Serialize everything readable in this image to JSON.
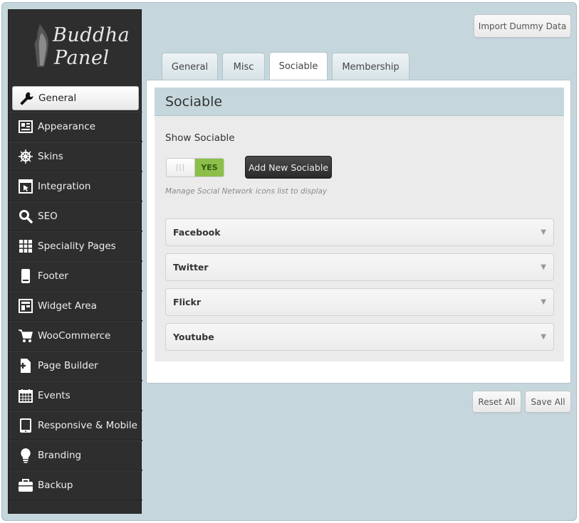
{
  "app": {
    "logo_line1": "Buddha",
    "logo_line2": "Panel"
  },
  "sidebar": {
    "items": [
      {
        "label": "General",
        "icon": "wrench-icon",
        "active": true
      },
      {
        "label": "Appearance",
        "icon": "newspaper-icon"
      },
      {
        "label": "Skins",
        "icon": "ship-wheel-icon"
      },
      {
        "label": "Integration",
        "icon": "window-cursor-icon"
      },
      {
        "label": "SEO",
        "icon": "search-icon"
      },
      {
        "label": "Speciality Pages",
        "icon": "grid-icon"
      },
      {
        "label": "Footer",
        "icon": "phone-device-icon"
      },
      {
        "label": "Widget Area",
        "icon": "layout-icon"
      },
      {
        "label": "WooCommerce",
        "icon": "cart-icon"
      },
      {
        "label": "Page Builder",
        "icon": "page-add-icon"
      },
      {
        "label": "Events",
        "icon": "calendar-icon"
      },
      {
        "label": "Responsive & Mobile",
        "icon": "tablet-icon"
      },
      {
        "label": "Branding",
        "icon": "lightbulb-icon"
      },
      {
        "label": "Backup",
        "icon": "briefcase-icon"
      }
    ]
  },
  "header": {
    "import_label": "Import Dummy Data"
  },
  "tabs": [
    {
      "label": "General"
    },
    {
      "label": "Misc"
    },
    {
      "label": "Sociable",
      "active": true
    },
    {
      "label": "Membership"
    }
  ],
  "section": {
    "title": "Sociable",
    "show_label": "Show Sociable",
    "toggle_on": "YES",
    "add_button": "Add New Sociable",
    "hint": "Manage Social Network icons list to display",
    "networks": [
      {
        "label": "Facebook"
      },
      {
        "label": "Twitter"
      },
      {
        "label": "Flickr"
      },
      {
        "label": "Youtube"
      }
    ]
  },
  "footer": {
    "reset_label": "Reset All",
    "save_label": "Save All"
  },
  "colors": {
    "frame_bg": "#c5d7dc",
    "sidebar_bg": "#2e2e2e",
    "toggle_on": "#8cbf4a"
  }
}
